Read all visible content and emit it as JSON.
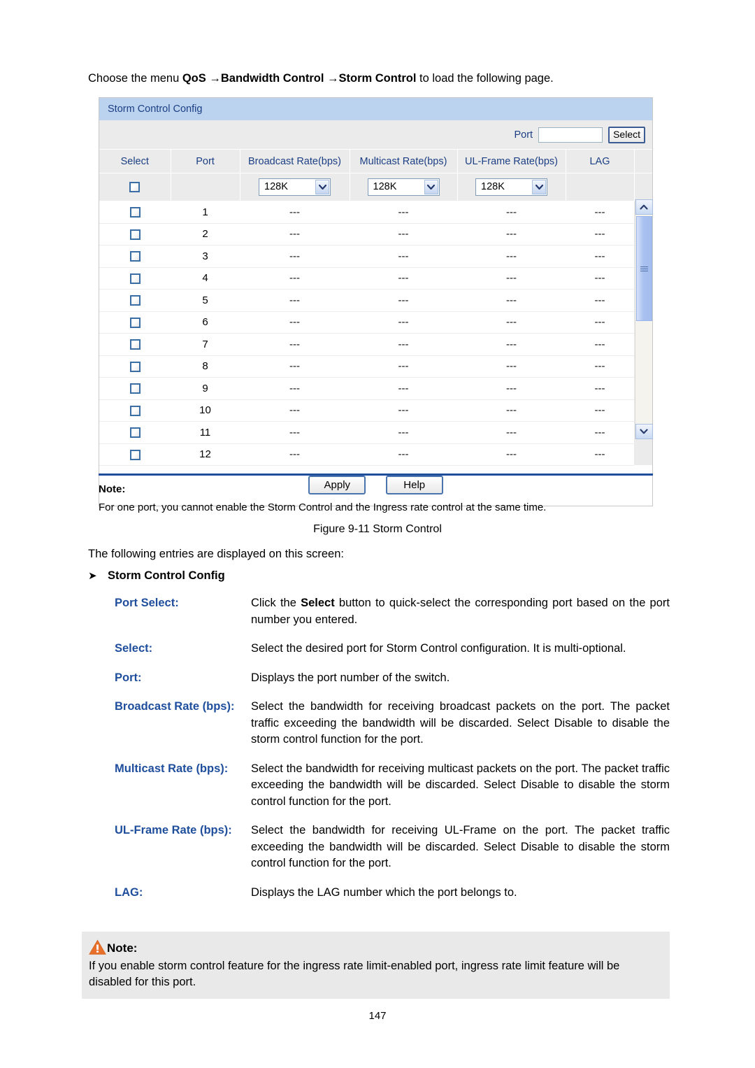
{
  "intro": {
    "prefix": "Choose the menu ",
    "menu1": "QoS",
    "sep1": " →",
    "menu2": "Bandwidth Control",
    "sep2": " →",
    "menu3": "Storm Control",
    "suffix": " to load the following page."
  },
  "panel": {
    "title": "Storm Control Config",
    "toolbar": {
      "port_label": "Port",
      "port_value": "",
      "port_placeholder": "",
      "select_button": "Select"
    },
    "columns": [
      "Select",
      "Port",
      "Broadcast Rate(bps)",
      "Multicast Rate(bps)",
      "UL-Frame Rate(bps)",
      "LAG"
    ],
    "config_row": {
      "broadcast_rate": "128K",
      "multicast_rate": "128K",
      "ulframe_rate": "128K"
    },
    "rows": [
      {
        "port": "1",
        "broadcast": "---",
        "multicast": "---",
        "ulframe": "---",
        "lag": "---"
      },
      {
        "port": "2",
        "broadcast": "---",
        "multicast": "---",
        "ulframe": "---",
        "lag": "---"
      },
      {
        "port": "3",
        "broadcast": "---",
        "multicast": "---",
        "ulframe": "---",
        "lag": "---"
      },
      {
        "port": "4",
        "broadcast": "---",
        "multicast": "---",
        "ulframe": "---",
        "lag": "---"
      },
      {
        "port": "5",
        "broadcast": "---",
        "multicast": "---",
        "ulframe": "---",
        "lag": "---"
      },
      {
        "port": "6",
        "broadcast": "---",
        "multicast": "---",
        "ulframe": "---",
        "lag": "---"
      },
      {
        "port": "7",
        "broadcast": "---",
        "multicast": "---",
        "ulframe": "---",
        "lag": "---"
      },
      {
        "port": "8",
        "broadcast": "---",
        "multicast": "---",
        "ulframe": "---",
        "lag": "---"
      },
      {
        "port": "9",
        "broadcast": "---",
        "multicast": "---",
        "ulframe": "---",
        "lag": "---"
      },
      {
        "port": "10",
        "broadcast": "---",
        "multicast": "---",
        "ulframe": "---",
        "lag": "---"
      },
      {
        "port": "11",
        "broadcast": "---",
        "multicast": "---",
        "ulframe": "---",
        "lag": "---"
      },
      {
        "port": "12",
        "broadcast": "---",
        "multicast": "---",
        "ulframe": "---",
        "lag": "---"
      }
    ],
    "apply_button": "Apply",
    "help_button": "Help"
  },
  "figure_note": {
    "title": "Note:",
    "body": "For one port, you cannot enable the Storm Control and the Ingress rate control at the same time."
  },
  "figure_caption": "Figure 9-11 Storm Control",
  "lead": "The following entries are displayed on this screen:",
  "section": {
    "arrow": "➤",
    "title": "Storm Control Config"
  },
  "definitions": [
    {
      "term": "Port Select:",
      "desc_pre": "Click the ",
      "desc_bold": "Select",
      "desc_post": " button to quick-select the corresponding port based on the port number you entered."
    },
    {
      "term": "Select:",
      "desc_pre": "Select the desired port for Storm Control configuration. It is multi-optional.",
      "desc_bold": "",
      "desc_post": ""
    },
    {
      "term": "Port:",
      "desc_pre": "Displays the port number of the switch.",
      "desc_bold": "",
      "desc_post": ""
    },
    {
      "term": "Broadcast Rate (bps):",
      "desc_pre": "Select the bandwidth for receiving broadcast packets on the port. The packet traffic exceeding the bandwidth will be discarded. Select Disable to disable the storm control function for the port.",
      "desc_bold": "",
      "desc_post": ""
    },
    {
      "term": "Multicast Rate (bps):",
      "desc_pre": "Select the bandwidth for receiving multicast packets on the port. The packet traffic exceeding the bandwidth will be discarded. Select Disable to disable the storm control function for the port.",
      "desc_bold": "",
      "desc_post": ""
    },
    {
      "term": "UL-Frame Rate (bps):",
      "desc_pre": "Select the bandwidth for receiving UL-Frame on the port. The packet traffic exceeding the bandwidth will be discarded. Select Disable to disable the storm control function for the port.",
      "desc_bold": "",
      "desc_post": ""
    },
    {
      "term": "LAG:",
      "desc_pre": "Displays the LAG number which the port belongs to.",
      "desc_bold": "",
      "desc_post": ""
    }
  ],
  "bottom_note": {
    "title": "Note:",
    "body": "If you enable storm control feature for the ingress rate limit-enabled port, ingress rate limit feature will be disabled for this port."
  },
  "page_number": "147",
  "colors": {
    "panel_title_bg": "#bcd3f0",
    "panel_title_text": "#1c3f84",
    "header_bg": "#ebebeb",
    "accent_blue": "#1f4e9c",
    "warn_orange": "#e8702a",
    "scroll_thumb": "#a9c1ef",
    "note_bg": "#e9e9e9"
  }
}
